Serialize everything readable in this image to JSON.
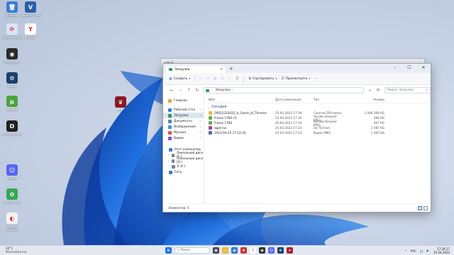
{
  "desktop": {
    "icons": [
      {
        "label": "Корзина",
        "icon": "recycle-bin-icon",
        "color": "#3b7fd3",
        "glyph": "🗑"
      },
      {
        "label": "vegas18.0 Pro",
        "icon": "vegas-icon",
        "color": "#2c5fa8",
        "glyph": "V"
      },
      {
        "label": "Nutzerprogramm",
        "icon": "app-icon",
        "color": "#d9e4f5",
        "glyph": "⟳"
      },
      {
        "label": "Яндекс",
        "icon": "yandex-browser-icon",
        "color": "#ffffff",
        "glyph": "Y"
      },
      {
        "label": "OBS Studio",
        "icon": "obs-icon",
        "color": "#2a2a2a",
        "glyph": "◉"
      },
      {
        "label": "Steam",
        "icon": "steam-icon",
        "color": "#1b3f6b",
        "glyph": "⚙"
      },
      {
        "label": "uTorrent",
        "icon": "utorrent-icon",
        "color": "#49a63a",
        "glyph": "µ"
      },
      {
        "label": "Stranded Deep",
        "icon": "game-icon",
        "color": "#222222",
        "glyph": "D"
      },
      {
        "label": "Discord",
        "icon": "discord-icon",
        "color": "#5865f2",
        "glyph": "☺"
      },
      {
        "label": "GeForce Now",
        "icon": "geforce-icon",
        "color": "#3aa655",
        "glyph": "✿"
      },
      {
        "label": "Process Explorer",
        "icon": "process-icon",
        "color": "#f4f4f4",
        "glyph": "◐"
      },
      {
        "label": "S.T.",
        "icon": "game-shortcut-icon",
        "color": "#8a1a22",
        "glyph": "♛"
      }
    ]
  },
  "behind_window": {
    "title": "новый"
  },
  "window": {
    "tab_title": "Загрузки",
    "new_tab": "+",
    "controls": {
      "minimize": "–",
      "maximize": "☐",
      "close": "✕"
    },
    "toolbar": {
      "create_label": "Создать",
      "sort_label": "Сортировать",
      "view_label": "Просмотреть",
      "more_label": "···"
    },
    "address": {
      "path": "Загрузки",
      "search_placeholder": "Поиск: Загрузки"
    },
    "sidebar": {
      "quick": [
        {
          "label": "Главная",
          "color": "#e8a53a"
        },
        {
          "label": "Рабочий стол",
          "color": "#3b7fd3"
        },
        {
          "label": "Загрузки",
          "color": "#2f9b5c"
        },
        {
          "label": "Документы",
          "color": "#5a7fb8"
        },
        {
          "label": "Изображения",
          "color": "#3a9ad9"
        },
        {
          "label": "Музыка",
          "color": "#e0573a"
        },
        {
          "label": "Видео",
          "color": "#8a4fc0"
        }
      ],
      "tree": [
        {
          "label": "Этот компьютер",
          "color": "#3b7fd3"
        },
        {
          "label": "Локальный диск (C:)",
          "color": "#7a8796"
        },
        {
          "label": "Локальный диск (D:)",
          "color": "#7a8796"
        },
        {
          "label": "E (E:)",
          "color": "#7a8796"
        },
        {
          "label": "Сеть",
          "color": "#3b7fd3"
        }
      ]
    },
    "columns": {
      "name": "Имя",
      "date": "Дата изменения",
      "type": "Тип",
      "size": "Размер"
    },
    "group": "Сегодня",
    "files": [
      {
        "name": "29622333032_A_Game_of_Thrones",
        "date": "25.04.2023 17:39",
        "type": "Сжатая ZIP-папка",
        "size": "3 006 399 КБ",
        "color": "#e8b73a"
      },
      {
        "name": "Frame 1784 (1)",
        "date": "25.04.2023 17:35",
        "type": "Yandex Browser JPEG...",
        "size": "484 КБ",
        "color": "#6aa84f"
      },
      {
        "name": "Frame 1784",
        "date": "25.04.2023 17:34",
        "type": "Yandex Browser JPEG...",
        "size": "947 КБ",
        "color": "#6aa84f"
      },
      {
        "name": "agot-rus",
        "date": "25.04.2023 17:31",
        "type": "rar Archive",
        "size": "2 087 КБ",
        "color": "#a04a9a"
      },
      {
        "name": "2023-04-25 17-12-43",
        "date": "25.04.2023 17:23",
        "type": "Видео MKV",
        "size": "1 005 КБ",
        "color": "#4a6fb0"
      }
    ],
    "status": "Элементов: 5"
  },
  "taskbar": {
    "weather_temp": "22°C",
    "weather_desc": "Малооблачно",
    "search_placeholder": "Поиск",
    "lang": "РУС",
    "time": "17:39:17",
    "date": "25.04.2023"
  }
}
